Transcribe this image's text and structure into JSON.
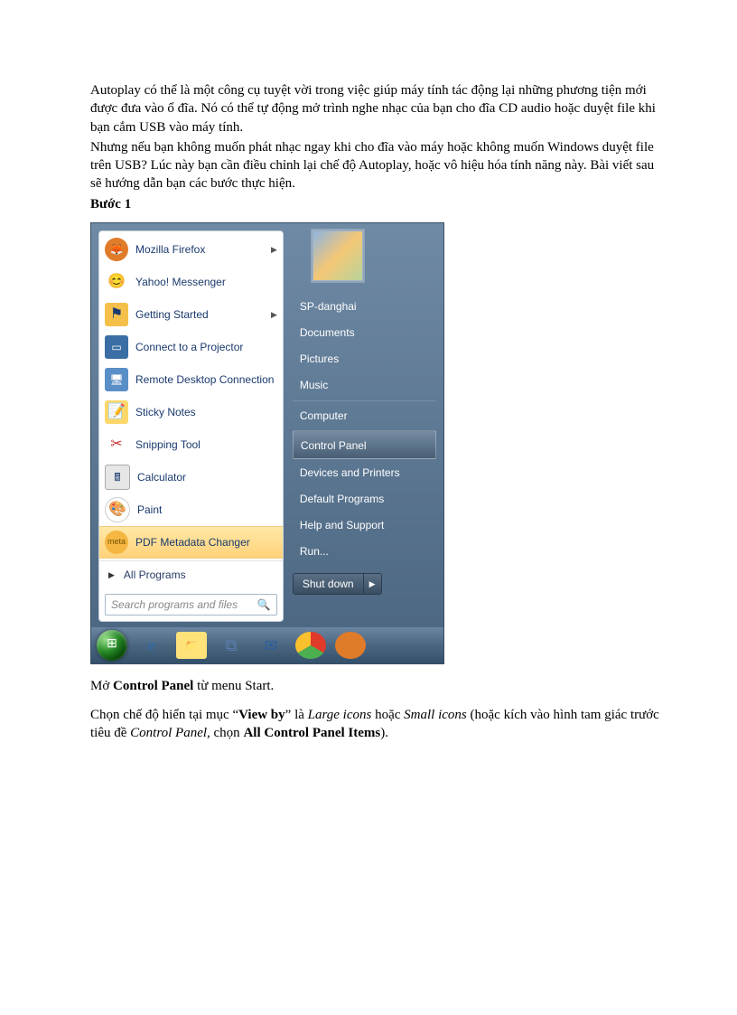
{
  "intro": {
    "p1": "Autoplay có thể là một công cụ tuyệt vời trong việc giúp máy tính tác động lại những phương tiện mới được đưa vào ổ đĩa. Nó có thể tự động mở trình nghe nhạc của bạn cho đĩa CD audio hoặc duyệt file khi bạn cắm USB vào máy tính.",
    "p2": "Nhưng nếu bạn không muốn phát nhạc ngay khi cho đĩa vào máy hoặc không muốn Windows duyệt file trên USB? Lúc này bạn cần điều chỉnh lại chế độ Autoplay, hoặc vô hiệu hóa tính năng này. Bài viết sau sẽ hướng dẫn bạn các bước thực hiện."
  },
  "step_label": "Bước 1",
  "start_menu": {
    "programs": [
      {
        "label": "Mozilla Firefox",
        "submenu": true,
        "icon": "firefox-icon",
        "cls": "ic-ff",
        "glyph": "🦊"
      },
      {
        "label": "Yahoo! Messenger",
        "submenu": false,
        "icon": "yahoo-icon",
        "cls": "ic-ym",
        "glyph": "😊"
      },
      {
        "label": "Getting Started",
        "submenu": true,
        "icon": "getting-started-icon",
        "cls": "ic-gs",
        "glyph": "⚑"
      },
      {
        "label": "Connect to a Projector",
        "submenu": false,
        "icon": "projector-icon",
        "cls": "ic-pr",
        "glyph": "▭"
      },
      {
        "label": "Remote Desktop Connection",
        "submenu": false,
        "icon": "remote-desktop-icon",
        "cls": "ic-rd",
        "glyph": "🖥"
      },
      {
        "label": "Sticky Notes",
        "submenu": false,
        "icon": "sticky-notes-icon",
        "cls": "ic-sn",
        "glyph": "📝"
      },
      {
        "label": "Snipping Tool",
        "submenu": false,
        "icon": "snipping-icon",
        "cls": "ic-sc",
        "glyph": "✂"
      },
      {
        "label": "Calculator",
        "submenu": false,
        "icon": "calculator-icon",
        "cls": "ic-ca",
        "glyph": "🖩"
      },
      {
        "label": "Paint",
        "submenu": false,
        "icon": "paint-icon",
        "cls": "ic-pa",
        "glyph": "🎨"
      },
      {
        "label": "PDF Metadata Changer",
        "submenu": false,
        "icon": "pdf-meta-icon",
        "cls": "ic-pm",
        "glyph": "meta",
        "hl": true
      }
    ],
    "all_programs": "All Programs",
    "search_placeholder": "Search programs and files",
    "username": "SP-danghai",
    "right_items": [
      {
        "label": "Documents"
      },
      {
        "label": "Pictures"
      },
      {
        "label": "Music"
      },
      {
        "label": "Computer",
        "sep": true
      },
      {
        "label": "Control Panel",
        "sep": true,
        "hov": true
      },
      {
        "label": "Devices and Printers"
      },
      {
        "label": "Default Programs"
      },
      {
        "label": "Help and Support"
      },
      {
        "label": "Run..."
      }
    ],
    "shutdown": "Shut down"
  },
  "taskbar": [
    {
      "name": "start-orb",
      "cls": "orb",
      "glyph": "⊞"
    },
    {
      "name": "taskbar-ie-icon",
      "cls": "tb-icon ic-ie",
      "glyph": "e"
    },
    {
      "name": "taskbar-explorer-icon",
      "cls": "tb-icon ic-fl",
      "glyph": "📁"
    },
    {
      "name": "taskbar-openoffice-icon",
      "cls": "tb-icon ic-oo",
      "glyph": "⧉"
    },
    {
      "name": "taskbar-thunderbird-icon",
      "cls": "tb-icon ic-tb",
      "glyph": "✉"
    },
    {
      "name": "taskbar-chrome-icon",
      "cls": "tb-icon ic-ch",
      "glyph": ""
    },
    {
      "name": "taskbar-firefox-icon",
      "cls": "tb-icon ic-fx",
      "glyph": ""
    }
  ],
  "instr": {
    "line1_a": "Mở ",
    "line1_b": "Control Panel",
    "line1_c": " từ menu Start.",
    "line2_a": "Chọn chế độ hiển tại mục “",
    "line2_b": "View by",
    "line2_c": "” là ",
    "line2_d": "Large icons",
    "line2_e": " hoặc ",
    "line2_f": "Small icons",
    "line2_g": " (hoặc kích vào hình tam giác trước tiêu đề ",
    "line2_h": "Control Panel",
    "line2_i": ", chọn ",
    "line2_j": "All Control Panel Items",
    "line2_k": ")."
  }
}
